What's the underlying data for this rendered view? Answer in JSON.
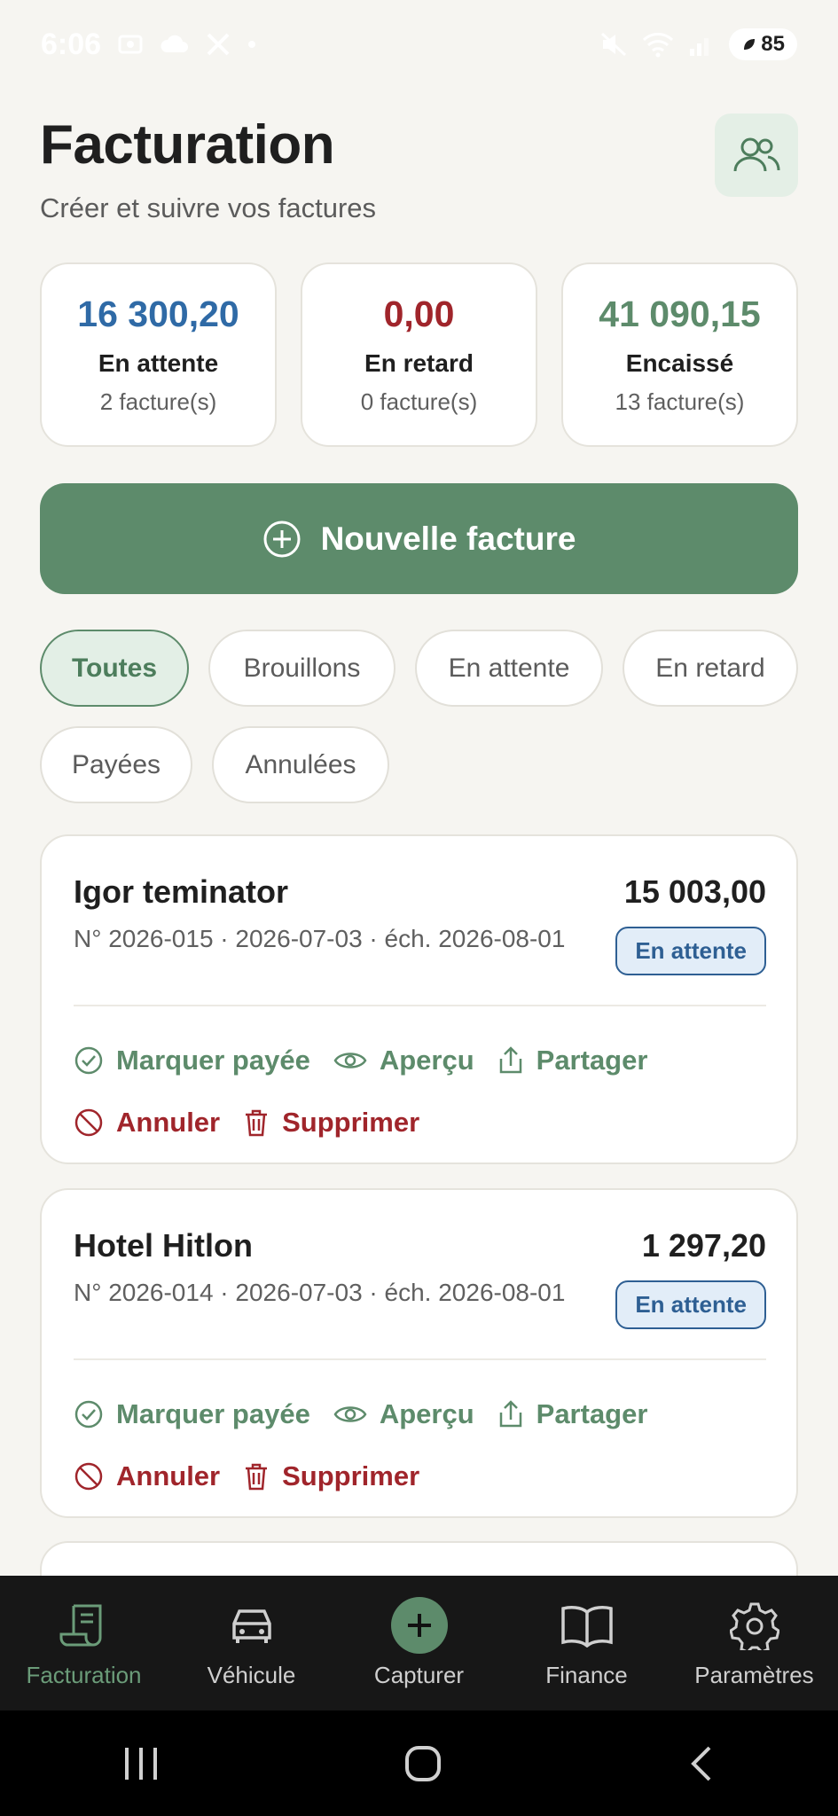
{
  "status": {
    "time": "6:06",
    "battery": "85"
  },
  "header": {
    "title": "Facturation",
    "subtitle": "Créer et suivre vos factures"
  },
  "stats": [
    {
      "value": "16 300,20",
      "label": "En attente",
      "count": "2 facture(s)",
      "color": "#2f6aa6"
    },
    {
      "value": "0,00",
      "label": "En retard",
      "count": "0 facture(s)",
      "color": "#a0252b"
    },
    {
      "value": "41 090,15",
      "label": "Encaissé",
      "count": "13 facture(s)",
      "color": "#5d8b6b"
    }
  ],
  "new_invoice_label": "Nouvelle facture",
  "filters": [
    "Toutes",
    "Brouillons",
    "En attente",
    "En retard",
    "Payées",
    "Annulées"
  ],
  "invoices": [
    {
      "client": "Igor teminator",
      "amount": "15 003,00",
      "meta": "N° 2026-015 · 2026-07-03 · éch. 2026-08-01",
      "status": "En attente"
    },
    {
      "client": "Hotel Hitlon",
      "amount": "1 297,20",
      "meta": "N° 2026-014 · 2026-07-03 · éch. 2026-08-01",
      "status": "En attente"
    }
  ],
  "actions": {
    "mark_paid": "Marquer payée",
    "preview": "Aperçu",
    "share": "Partager",
    "cancel": "Annuler",
    "delete": "Supprimer"
  },
  "nav": [
    {
      "label": "Facturation",
      "icon": "invoice-icon"
    },
    {
      "label": "Véhicule",
      "icon": "car-icon"
    },
    {
      "label": "Capturer",
      "icon": "plus-icon"
    },
    {
      "label": "Finance",
      "icon": "book-icon"
    },
    {
      "label": "Paramètres",
      "icon": "gear-icon"
    }
  ],
  "colors": {
    "accent": "#5d8b6b",
    "danger": "#a0252b",
    "pending": "#2f6aa6",
    "background": "#f6f5f1"
  }
}
